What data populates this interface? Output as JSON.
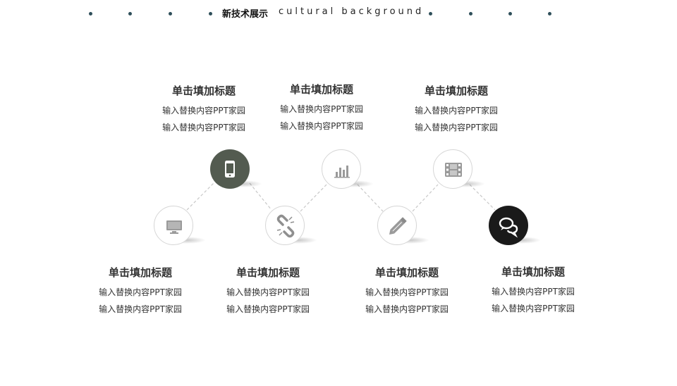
{
  "header": {
    "title": "新技术展示",
    "subtitle": "cultural background"
  },
  "items": [
    {
      "title": "单击填加标题",
      "line1": "输入替换内容PPT家园",
      "line2": "输入替换内容PPT家园",
      "icon": "monitor-icon"
    },
    {
      "title": "单击填加标题",
      "line1": "输入替换内容PPT家园",
      "line2": "输入替换内容PPT家园",
      "icon": "phone-icon"
    },
    {
      "title": "单击填加标题",
      "line1": "输入替换内容PPT家园",
      "line2": "输入替换内容PPT家园",
      "icon": "link-icon"
    },
    {
      "title": "单击填加标题",
      "line1": "输入替换内容PPT家园",
      "line2": "输入替换内容PPT家园",
      "icon": "bar-chart-icon"
    },
    {
      "title": "单击填加标题",
      "line1": "输入替换内容PPT家园",
      "line2": "输入替换内容PPT家园",
      "icon": "pencil-icon"
    },
    {
      "title": "单击填加标题",
      "line1": "输入替换内容PPT家园",
      "line2": "输入替换内容PPT家园",
      "icon": "film-icon"
    },
    {
      "title": "单击填加标题",
      "line1": "输入替换内容PPT家园",
      "line2": "输入替换内容PPT家园",
      "icon": "chat-icon"
    }
  ],
  "colors": {
    "accent_green": "#535b50",
    "accent_black": "#1a1a1a",
    "dot": "#2f4f5a"
  }
}
